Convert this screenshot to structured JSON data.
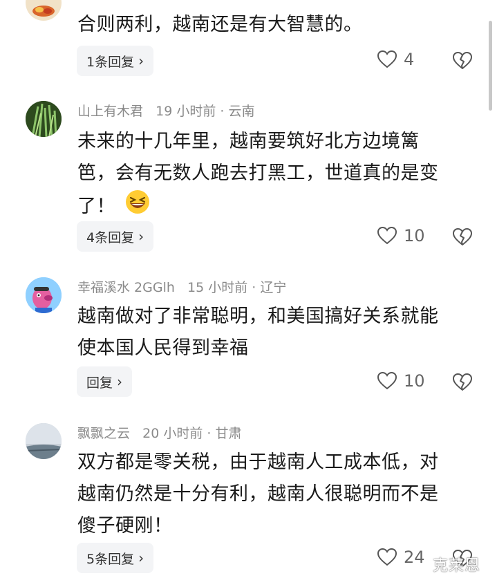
{
  "comments": [
    {
      "author": "",
      "time": "",
      "location": "",
      "text": "合则两利，越南还是有大智慧的。",
      "reply_label": "1条回复",
      "likes": "4"
    },
    {
      "author": "山上有木君",
      "time": "19 小时前",
      "location": "云南",
      "text_lines": [
        "未来的十几年里，越南要筑好北方边境篱",
        "笆，会有无数人跑去打黑工，世道真的是变",
        "了！"
      ],
      "emoji": "grinning-squinting-face",
      "reply_label": "4条回复",
      "likes": "10"
    },
    {
      "author": "幸福溪水 2GGlh",
      "time": "15 小时前",
      "location": "辽宁",
      "text_lines": [
        "越南做对了非常聪明，和美国搞好关系就能",
        "使本国人民得到幸福"
      ],
      "reply_label": "回复",
      "likes": "10"
    },
    {
      "author": "飘飘之云",
      "time": "20 小时前",
      "location": "甘肃",
      "text_lines": [
        "双方都是零关税，由于越南人工成本低，对",
        "越南仍然是十分有利，越南人很聪明而不是",
        "傻子硬刚！"
      ],
      "reply_label": "5条回复",
      "likes": "24"
    }
  ],
  "separator": "·",
  "watermark": "克莱恩",
  "icons": {
    "like": "heart-outline-icon",
    "dislike": "broken-heart-icon",
    "reply": "chevron-right-icon"
  },
  "colors": {
    "meta": "#8a8a8a",
    "reply_bg": "#f3f4f6",
    "text": "#1a1a1a"
  }
}
